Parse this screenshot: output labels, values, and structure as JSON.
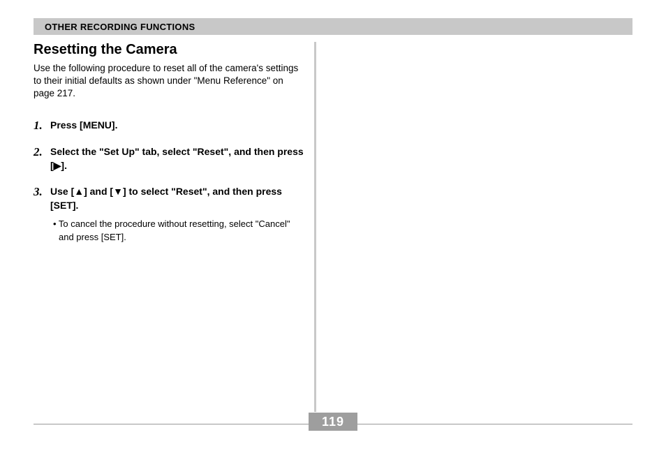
{
  "header": "OTHER RECORDING FUNCTIONS",
  "title": "Resetting the Camera",
  "intro": "Use the following procedure to reset all of the camera's settings to their initial defaults as shown under \"Menu Reference\" on page 217.",
  "steps": [
    {
      "num": "1.",
      "text": "Press [MENU]."
    },
    {
      "num": "2.",
      "text": "Select the \"Set Up\" tab, select \"Reset\", and then press [▶]."
    },
    {
      "num": "3.",
      "text": "Use [▲] and [▼] to select \"Reset\", and then press [SET].",
      "note": "• To cancel the procedure without resetting, select \"Cancel\" and press [SET]."
    }
  ],
  "pageNumber": "119"
}
